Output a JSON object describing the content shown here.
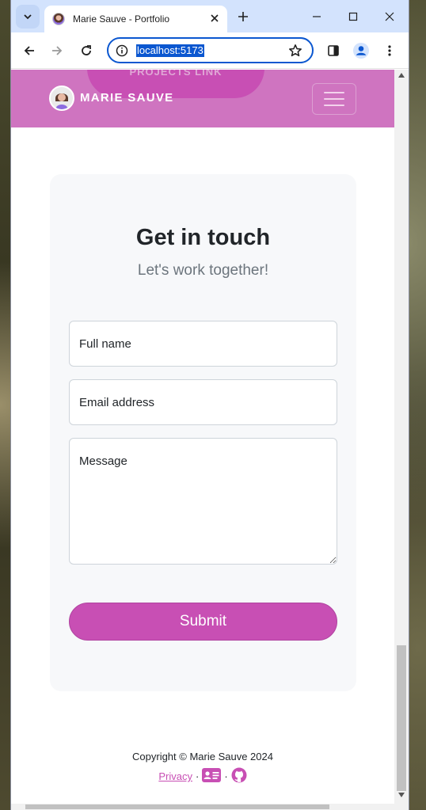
{
  "browser": {
    "tab_title": "Marie Sauve - Portfolio",
    "url": "localhost:5173"
  },
  "navbar": {
    "brand_name": "MARIE SAUVE",
    "ghost_link_label": "PROJECTS LINK"
  },
  "contact": {
    "heading": "Get in touch",
    "subheading": "Let's work together!",
    "name_placeholder": "Full name",
    "email_placeholder": "Email address",
    "message_placeholder": "Message",
    "submit_label": "Submit"
  },
  "footer": {
    "copyright": "Copyright © Marie Sauve 2024",
    "privacy_label": "Privacy",
    "separator": "·"
  },
  "colors": {
    "accent": "#c84fb4",
    "navbar": "#cf74c0",
    "tabstrip": "#d3e3fd"
  },
  "icons": [
    "chevron-down-icon",
    "close-icon",
    "plus-icon",
    "minimize-icon",
    "maximize-icon",
    "back-arrow-icon",
    "forward-arrow-icon",
    "reload-icon",
    "info-icon",
    "star-icon",
    "side-panel-icon",
    "profile-icon",
    "kebab-menu-icon",
    "contact-card-icon",
    "github-icon"
  ]
}
